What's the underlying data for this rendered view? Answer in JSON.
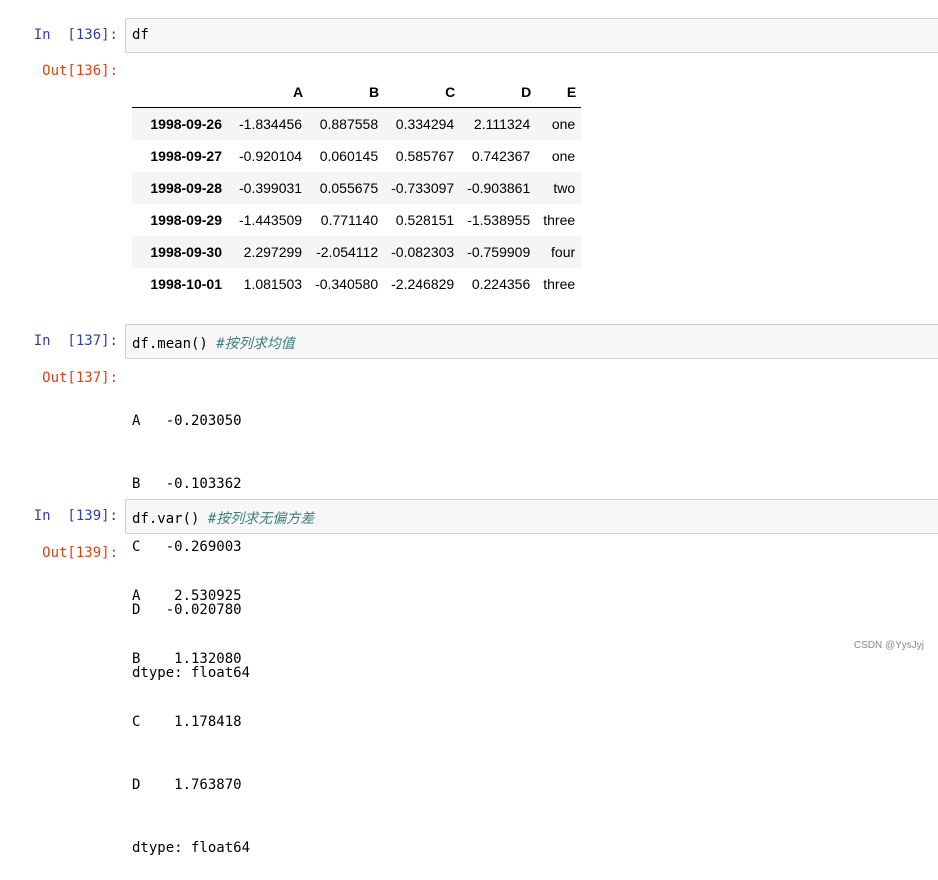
{
  "cells": [
    {
      "in_prompt": "In  [136]:",
      "code": "df",
      "comment": "",
      "out_prompt": "Out[136]:",
      "table": {
        "columns": [
          "",
          "A",
          "B",
          "C",
          "D",
          "E"
        ],
        "rows": [
          {
            "index": "1998-09-26",
            "values": [
              "-1.834456",
              "0.887558",
              "0.334294",
              "2.111324",
              "one"
            ]
          },
          {
            "index": "1998-09-27",
            "values": [
              "-0.920104",
              "0.060145",
              "0.585767",
              "0.742367",
              "one"
            ]
          },
          {
            "index": "1998-09-28",
            "values": [
              "-0.399031",
              "0.055675",
              "-0.733097",
              "-0.903861",
              "two"
            ]
          },
          {
            "index": "1998-09-29",
            "values": [
              "-1.443509",
              "0.771140",
              "0.528151",
              "-1.538955",
              "three"
            ]
          },
          {
            "index": "1998-09-30",
            "values": [
              "2.297299",
              "-2.054112",
              "-0.082303",
              "-0.759909",
              "four"
            ]
          },
          {
            "index": "1998-10-01",
            "values": [
              "1.081503",
              "-0.340580",
              "-2.246829",
              "0.224356",
              "three"
            ]
          }
        ]
      }
    },
    {
      "in_prompt": "In  [137]:",
      "code": "df.mean() ",
      "comment": "#按列求均值",
      "out_prompt": "Out[137]:",
      "lines": [
        "A   -0.203050",
        "B   -0.103362",
        "C   -0.269003",
        "D   -0.020780",
        "dtype: float64"
      ]
    },
    {
      "in_prompt": "In  [139]:",
      "code": "df.var() ",
      "comment": "#按列求无偏方差",
      "out_prompt": "Out[139]:",
      "lines": [
        "A    2.530925",
        "B    1.132080",
        "C    1.178418",
        "D    1.763870",
        "dtype: float64"
      ]
    }
  ],
  "watermark": "CSDN @YysJyj",
  "colors": {
    "in_prompt": "#303f9f",
    "out_prompt": "#d84315",
    "comment": "#408080",
    "input_bg": "#f7f7f7"
  }
}
